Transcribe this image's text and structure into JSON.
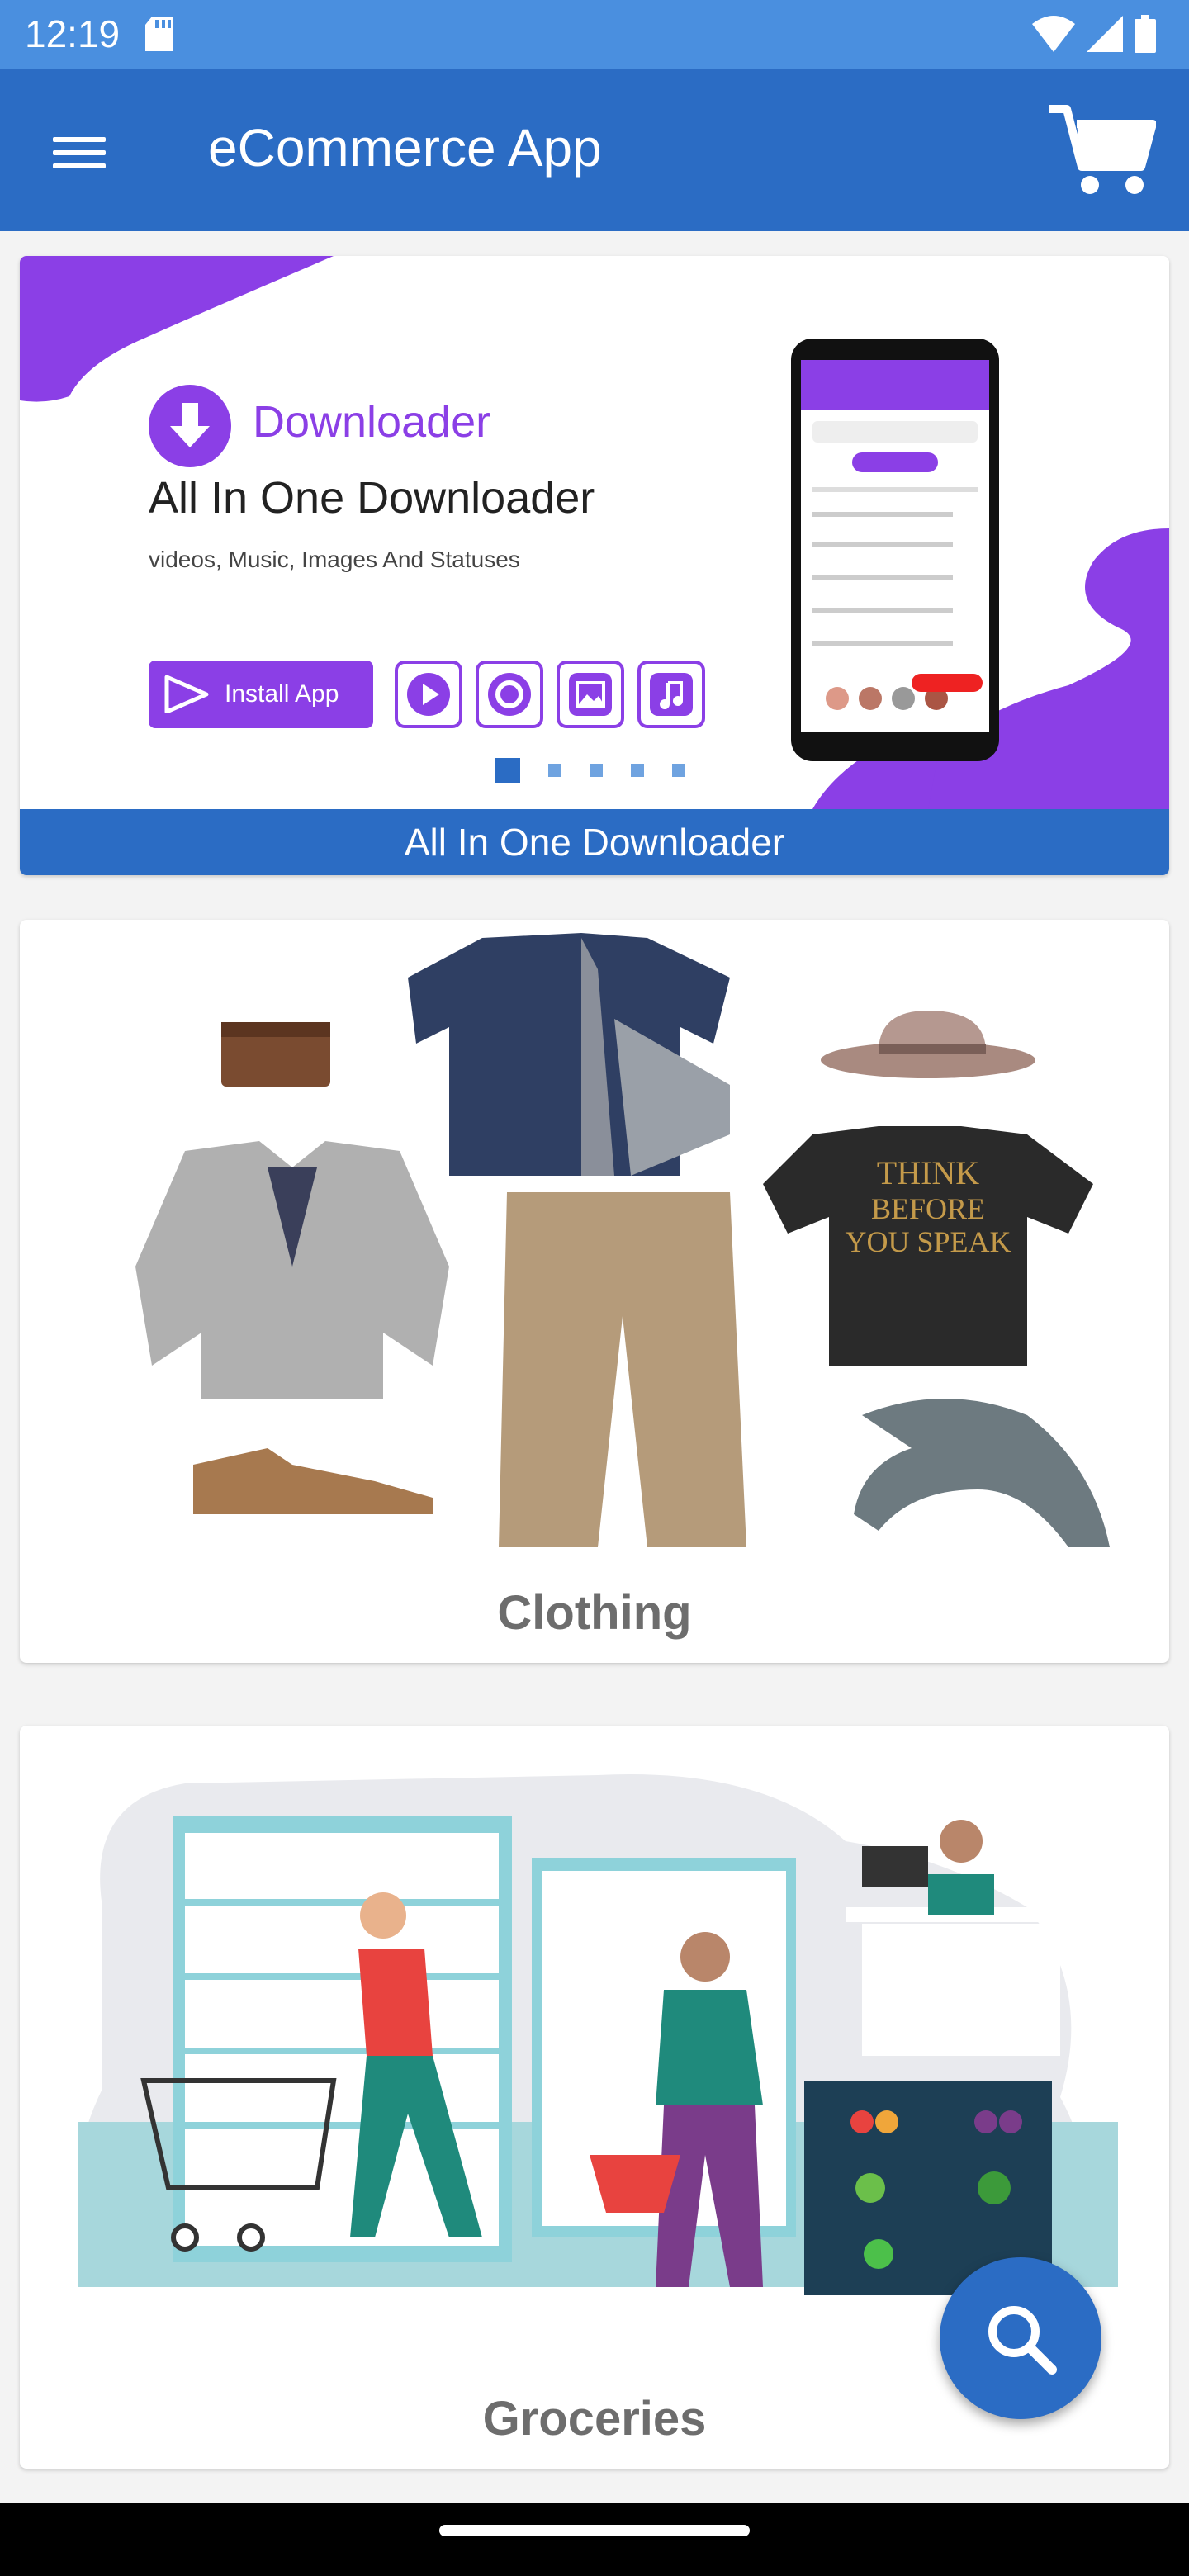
{
  "status_bar": {
    "time": "12:19"
  },
  "app_bar": {
    "title": "eCommerce App",
    "menu_icon": "hamburger-menu-icon",
    "cart_icon": "shopping-cart-icon"
  },
  "banner": {
    "app_name": "Downloader",
    "headline": "All In One Downloader",
    "subline": "videos, Music, Images And Statuses",
    "install_label": "Install App",
    "caption": "All In One Downloader",
    "page_count": 5,
    "active_page": 1
  },
  "categories": [
    {
      "label": "Clothing"
    },
    {
      "label": "Groceries"
    }
  ],
  "fab": {
    "icon": "search-icon"
  },
  "colors": {
    "primary": "#2b6cc4",
    "status": "#4a8fdf",
    "accent": "#8b3fe6"
  }
}
